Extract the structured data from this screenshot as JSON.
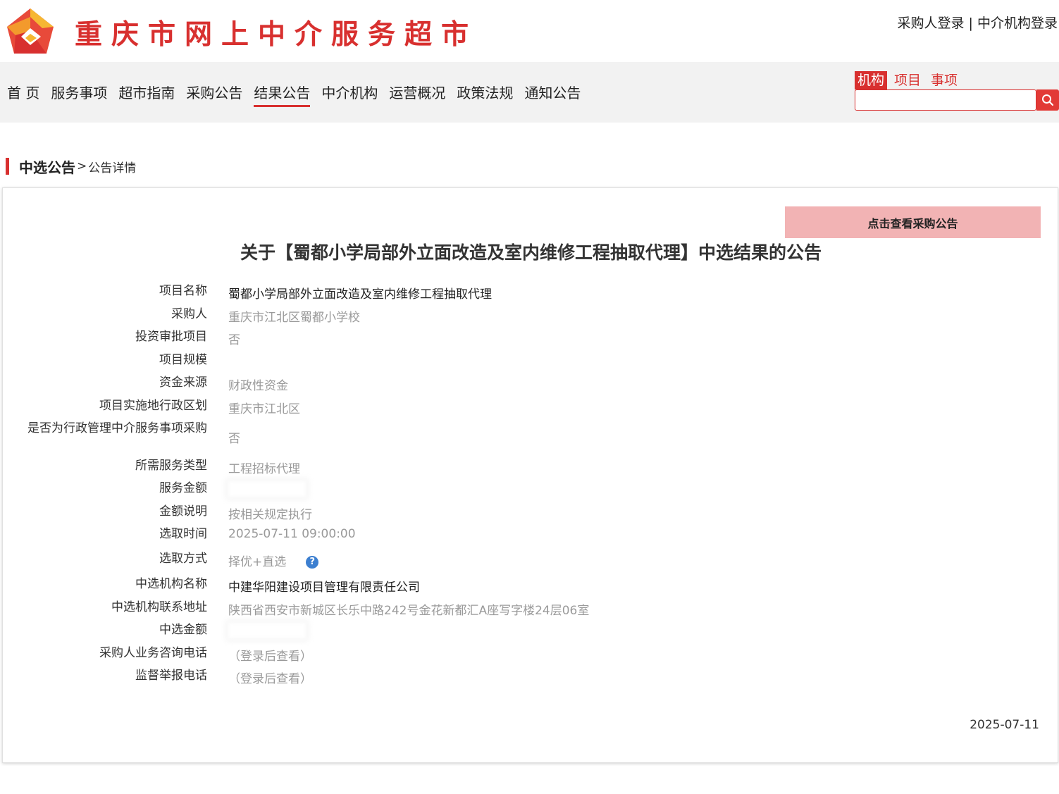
{
  "header": {
    "site_title": "重庆市网上中介服务超市",
    "login": {
      "buyer": "采购人登录",
      "sep": " | ",
      "agency": "中介机构登录"
    }
  },
  "nav": {
    "items": [
      {
        "label": "首 页"
      },
      {
        "label": "服务事项"
      },
      {
        "label": "超市指南"
      },
      {
        "label": "采购公告"
      },
      {
        "label": "结果公告",
        "active": true
      },
      {
        "label": "中介机构"
      },
      {
        "label": "运营概况"
      },
      {
        "label": "政策法规"
      },
      {
        "label": "通知公告"
      }
    ]
  },
  "search": {
    "tabs": [
      {
        "label": "机构",
        "active": true
      },
      {
        "label": "项目"
      },
      {
        "label": "事项"
      }
    ],
    "value": ""
  },
  "breadcrumb": {
    "main": "中选公告",
    "sep": ">",
    "sub": "公告详情"
  },
  "notice": {
    "view_button": "点击查看采购公告",
    "title": "关于【蜀都小学局部外立面改造及室内维修工程抽取代理】中选结果的公告",
    "fields": [
      {
        "label": "项目名称",
        "value": "蜀都小学局部外立面改造及室内维修工程抽取代理"
      },
      {
        "label": "采购人",
        "value": "重庆市江北区蜀都小学校"
      },
      {
        "label": "投资审批项目",
        "value": "否"
      },
      {
        "label": "项目规模",
        "value": ""
      },
      {
        "label": "资金来源",
        "value": "财政性资金"
      },
      {
        "label": "项目实施地行政区划",
        "value": "重庆市江北区"
      },
      {
        "label": "是否为行政管理中介服务事项采购",
        "value": "否"
      },
      {
        "label": "所需服务类型",
        "value": "工程招标代理"
      },
      {
        "label": "服务金额",
        "value": ""
      },
      {
        "label": "金额说明",
        "value": "按相关规定执行"
      },
      {
        "label": "选取时间",
        "value": "2025-07-11 09:00:00"
      },
      {
        "label": "选取方式",
        "value": "择优+直选"
      },
      {
        "label": "中选机构名称",
        "value": "中建华阳建设项目管理有限责任公司"
      },
      {
        "label": "中选机构联系地址",
        "value": "陕西省西安市新城区长乐中路242号金花新都汇A座写字楼24层06室"
      },
      {
        "label": "中选金额",
        "value": ""
      },
      {
        "label": "采购人业务咨询电话",
        "value": "（登录后查看）"
      },
      {
        "label": "监督举报电话",
        "value": "（登录后查看）"
      }
    ],
    "publish_date": "2025-07-11",
    "help_icon_glyph": "?"
  },
  "colors": {
    "brand_red": "#d8302f",
    "button_pink": "#f2b3b4",
    "nav_bg": "#f2f2f2"
  }
}
